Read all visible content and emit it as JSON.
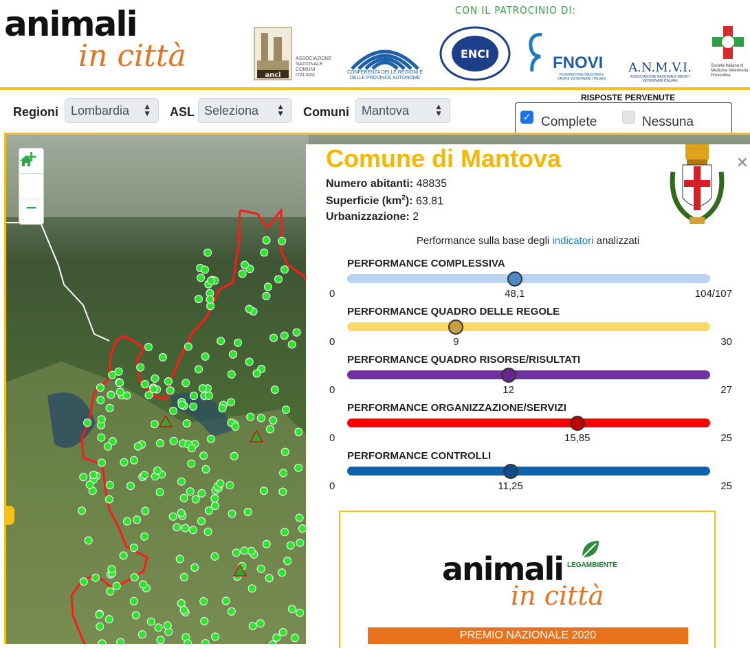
{
  "header": {
    "logo_word1": "animali",
    "logo_word2": "in città",
    "patronage_title": "CON IL PATROCINIO DI:",
    "sponsors": [
      {
        "name": "anci",
        "text": "ASSOCIAZIONE NAZIONALE COMUNI ITALIANI"
      },
      {
        "name": "conferenza",
        "text": "CONFERENZA DELLE REGIONI E DELLE PROVINCE AUTONOME"
      },
      {
        "name": "enci",
        "text": "ENCI"
      },
      {
        "name": "fnovi",
        "text": "FNOVI",
        "sub": "FEDERAZIONE NAZIONALE ORDINI VETERINARI ITALIANI"
      },
      {
        "name": "anmvi",
        "text": "A.N.M.V.I.",
        "sub": "ASSOCIAZIONE NAZIONALE MEDICI VETERINARI ITALIANI"
      },
      {
        "name": "simevep",
        "text": "Società Italiana di Medicina Veterinaria Preventiva"
      }
    ]
  },
  "filters": {
    "regioni_label": "Regioni",
    "regioni_value": "Lombardia",
    "asl_label": "ASL",
    "asl_value": "Seleziona",
    "comuni_label": "Comuni",
    "comuni_value": "Mantova"
  },
  "risposte": {
    "title": "RISPOSTE PERVENUTE",
    "complete_label": "Complete",
    "complete_checked": true,
    "nessuna_label": "Nessuna",
    "nessuna_checked": false
  },
  "map": {
    "zoom_in": "+",
    "zoom_out": "−"
  },
  "panel": {
    "title": "Comune di Mantova",
    "abitanti_label": "Numero abitanti:",
    "abitanti_value": "48835",
    "superficie_label": "Superficie (km",
    "superficie_sup": "2",
    "superficie_suffix": "):",
    "superficie_value": "63.81",
    "urbanizzazione_label": "Urbanizzazione:",
    "urbanizzazione_value": "2",
    "intro_before": "Performance sulla base degli",
    "intro_link": "indicatori",
    "intro_after": "analizzati",
    "close_icon": "×"
  },
  "performances": [
    {
      "label": "PERFORMANCE COMPLESSIVA",
      "min": "0",
      "value": "48,1",
      "max": "104/107",
      "fraction": 0.4617,
      "track_color": "#b9d2ef",
      "knob_color": "#4d88c9"
    },
    {
      "label": "PERFORMANCE QUADRO DELLE REGOLE",
      "min": "0",
      "value": "9",
      "max": "30",
      "fraction": 0.3,
      "track_color": "#fdd86a",
      "knob_color": "#c8a044"
    },
    {
      "label": "PERFORMANCE QUADRO RISORSE/RISULTATI",
      "min": "0",
      "value": "12",
      "max": "27",
      "fraction": 0.4444,
      "track_color": "#7030a0",
      "knob_color": "#66288f"
    },
    {
      "label": "PERFORMANCE ORGANIZZAZIONE/SERVIZI",
      "min": "0",
      "value": "15,85",
      "max": "25",
      "fraction": 0.634,
      "track_color": "#ff0000",
      "knob_color": "#c00000"
    },
    {
      "label": "PERFORMANCE CONTROLLI",
      "min": "0",
      "value": "11,25",
      "max": "25",
      "fraction": 0.45,
      "track_color": "#0f62ae",
      "knob_color": "#0c4d8a"
    }
  ],
  "promo": {
    "word1": "animali",
    "word2": "in città",
    "legambiente": "LEGAMBIENTE",
    "banner": "PREMIO NAZIONALE 2020"
  }
}
